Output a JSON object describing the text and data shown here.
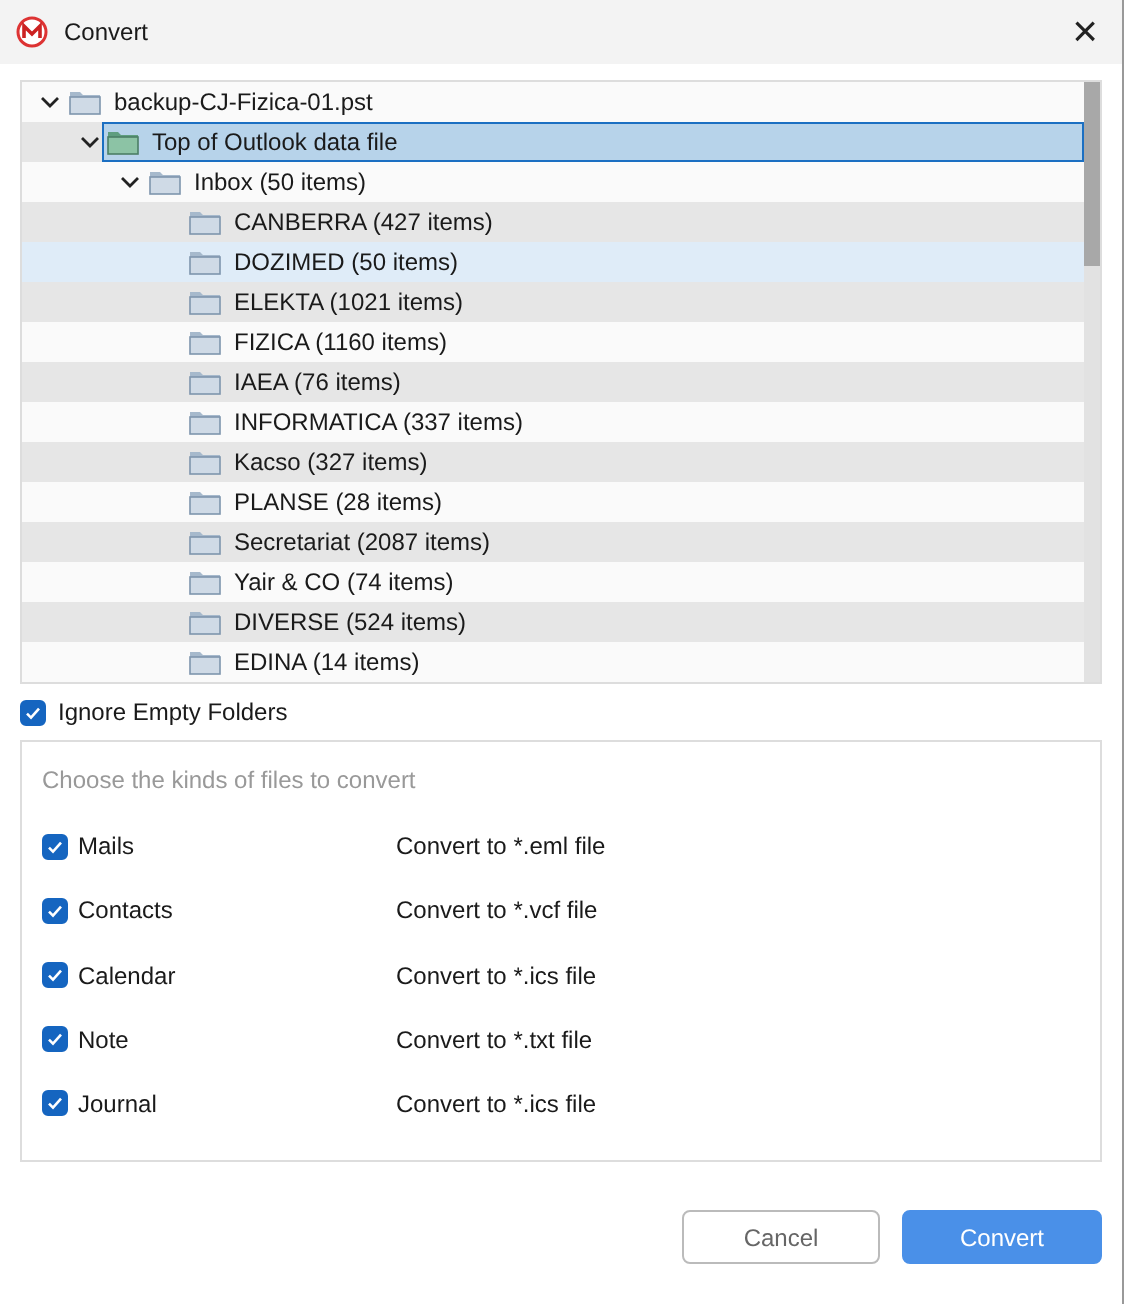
{
  "window": {
    "title": "Convert",
    "close": "×"
  },
  "tree": [
    {
      "label": "backup-CJ-Fizica-01.pst",
      "expanded": true,
      "selected": false,
      "highlighted": false,
      "children": [
        {
          "label": "Top of Outlook data file",
          "expanded": true,
          "selected": true,
          "highlighted": false,
          "kind": "root",
          "children": [
            {
              "label": "Inbox (50 items)",
              "expanded": true,
              "selected": false,
              "highlighted": false,
              "children": [
                {
                  "label": "CANBERRA (427 items)",
                  "selected": false,
                  "highlighted": false
                },
                {
                  "label": "DOZIMED (50 items)",
                  "selected": false,
                  "highlighted": true
                },
                {
                  "label": "ELEKTA (1021 items)",
                  "selected": false,
                  "highlighted": false
                },
                {
                  "label": "FIZICA (1160 items)",
                  "selected": false,
                  "highlighted": false
                },
                {
                  "label": "IAEA (76 items)",
                  "selected": false,
                  "highlighted": false
                },
                {
                  "label": "INFORMATICA (337 items)",
                  "selected": false,
                  "highlighted": false
                },
                {
                  "label": "Kacso (327 items)",
                  "selected": false,
                  "highlighted": false
                },
                {
                  "label": "PLANSE (28 items)",
                  "selected": false,
                  "highlighted": false
                },
                {
                  "label": "Secretariat (2087 items)",
                  "selected": false,
                  "highlighted": false
                },
                {
                  "label": "Yair & CO (74 items)",
                  "selected": false,
                  "highlighted": false
                },
                {
                  "label": "DIVERSE (524 items)",
                  "selected": false,
                  "highlighted": false
                },
                {
                  "label": "EDINA (14 items)",
                  "selected": false,
                  "highlighted": false
                }
              ]
            }
          ]
        }
      ]
    }
  ],
  "ignore_empty": {
    "label": "Ignore Empty Folders",
    "checked": true
  },
  "kinds_panel": {
    "heading": "Choose the kinds of files to convert",
    "items": [
      {
        "label": "Mails",
        "checked": true,
        "target": "Convert to *.eml file"
      },
      {
        "label": "Contacts",
        "checked": true,
        "target": "Convert to *.vcf file"
      },
      {
        "label": "Calendar",
        "checked": true,
        "target": "Convert to *.ics file"
      },
      {
        "label": "Note",
        "checked": true,
        "target": "Convert to *.txt file"
      },
      {
        "label": "Journal",
        "checked": true,
        "target": "Convert to *.ics file"
      }
    ]
  },
  "buttons": [
    {
      "label": "Cancel",
      "kind": "secondary"
    },
    {
      "label": "Convert",
      "kind": "primary"
    }
  ]
}
